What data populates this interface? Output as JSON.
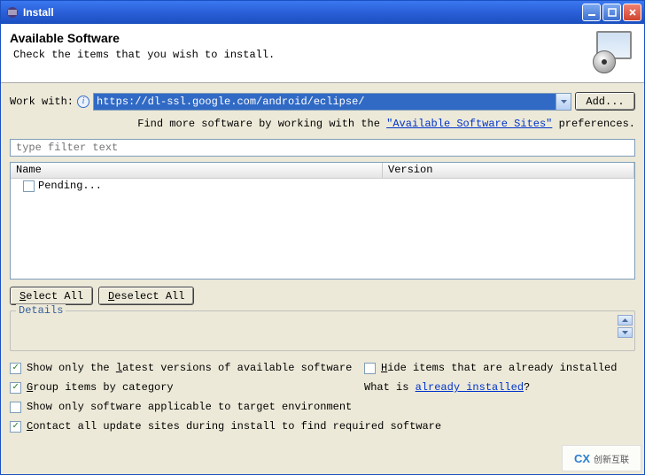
{
  "window": {
    "title": "Install"
  },
  "header": {
    "title": "Available Software",
    "subtitle": "Check the items that you wish to install."
  },
  "workwith": {
    "label": "Work with:",
    "value": "https://dl-ssl.google.com/android/eclipse/",
    "add_btn": "Add..."
  },
  "hint": {
    "prefix": "Find more software by working with the ",
    "link": "\"Available Software Sites\"",
    "suffix": " preferences."
  },
  "filter": {
    "placeholder": "type filter text"
  },
  "tree": {
    "col_name": "Name",
    "col_version": "Version",
    "rows": [
      {
        "label": "Pending...",
        "checked": false
      }
    ]
  },
  "buttons": {
    "select_all": "Select All",
    "deselect_all": "Deselect All"
  },
  "details": {
    "legend": "Details"
  },
  "options": {
    "show_latest": {
      "label": "Show only the latest versions of available software",
      "checked": true,
      "hotkey": "l"
    },
    "hide_installed": {
      "label": "Hide items that are already installed",
      "checked": false,
      "hotkey": "H"
    },
    "group_category": {
      "label": "Group items by category",
      "checked": true,
      "hotkey": "G"
    },
    "what_is": {
      "prefix": "What is ",
      "link": "already installed",
      "suffix": "?"
    },
    "applicable_env": {
      "label": "Show only software applicable to target environment",
      "checked": false
    },
    "contact_sites": {
      "label": "Contact all update sites during install to find required software",
      "checked": true,
      "hotkey": "C"
    }
  },
  "watermark": {
    "logo": "CX",
    "text": "创新互联"
  }
}
